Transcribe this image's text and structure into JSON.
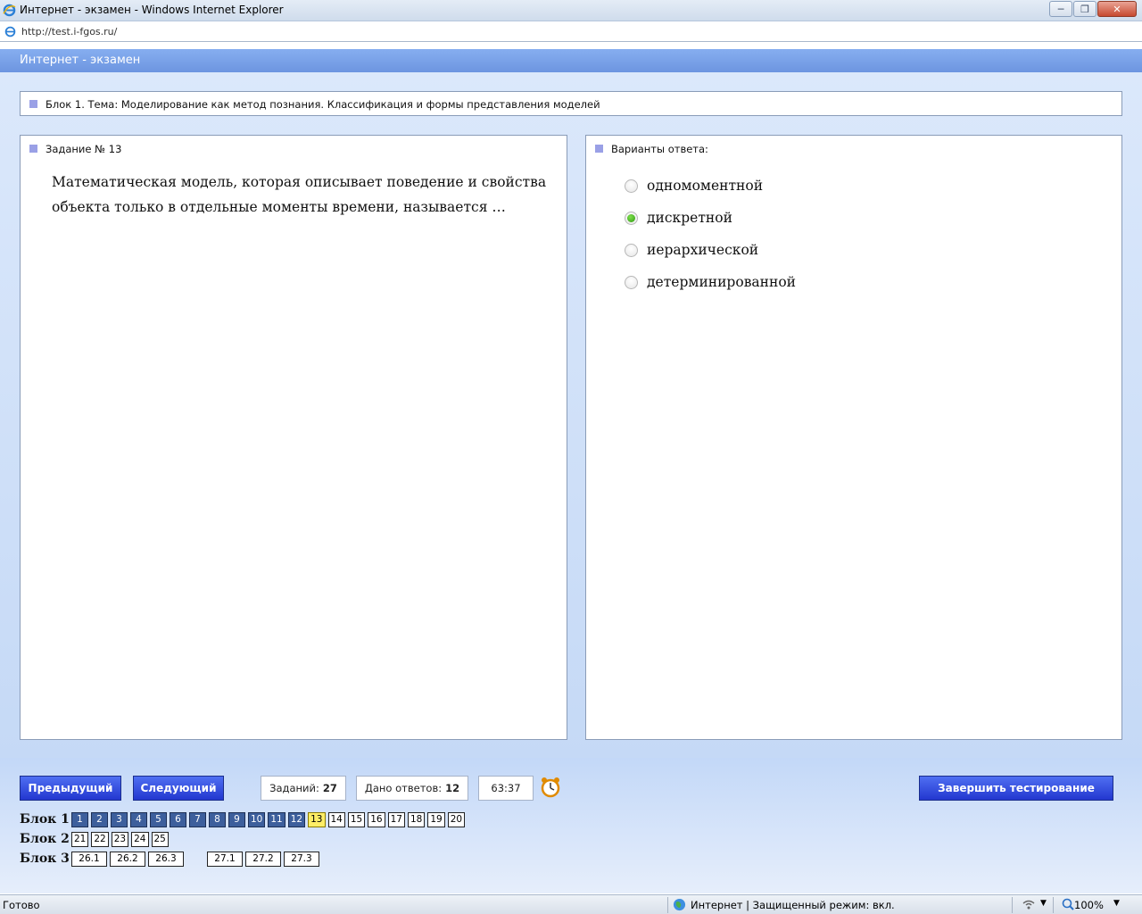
{
  "window": {
    "title": "Интернет - экзамен - Windows Internet Explorer"
  },
  "address": {
    "url": "http://test.i-fgos.ru/"
  },
  "page": {
    "header_title": "Интернет - экзамен",
    "block_title": "Блок 1. Тема: Моделирование как метод познания. Классификация и формы представления моделей"
  },
  "task": {
    "label": "Задание № 13",
    "question": "Математическая модель, которая описывает поведение и свойства объекта только в отдельные моменты времени, называется …"
  },
  "answers": {
    "label": "Варианты ответа:",
    "options": [
      {
        "text": "одномоментной",
        "selected": false
      },
      {
        "text": "дискретной",
        "selected": true
      },
      {
        "text": "иерархической",
        "selected": false
      },
      {
        "text": "детерминированной",
        "selected": false
      }
    ]
  },
  "controls": {
    "prev_label": "Предыдущий",
    "next_label": "Следующий",
    "tasks_label": "Заданий:",
    "tasks_count": "27",
    "answered_label": "Дано ответов:",
    "answered_count": "12",
    "timer": "63:37",
    "finish_label": "Завершить тестирование"
  },
  "navigator": {
    "blocks": [
      {
        "label": "Блок 1",
        "items": [
          "1",
          "2",
          "3",
          "4",
          "5",
          "6",
          "7",
          "8",
          "9",
          "10",
          "11",
          "12",
          "13",
          "14",
          "15",
          "16",
          "17",
          "18",
          "19",
          "20"
        ]
      },
      {
        "label": "Блок 2",
        "items": [
          "21",
          "22",
          "23",
          "24",
          "25"
        ]
      },
      {
        "label": "Блок 3",
        "items": [
          "26.1",
          "26.2",
          "26.3",
          "27.1",
          "27.2",
          "27.3"
        ]
      }
    ],
    "answered_items": [
      "1",
      "2",
      "3",
      "4",
      "5",
      "6",
      "7",
      "8",
      "9",
      "10",
      "11",
      "12"
    ],
    "current_item": "13"
  },
  "status": {
    "left": "Готово",
    "zone": "Интернет | Защищенный режим: вкл.",
    "zoom": "100%"
  },
  "colors": {
    "header_blue": "#7aa2ea",
    "button_blue": "#2f45dc",
    "answered_cell": "#3d5f9c",
    "current_cell": "#ffee66",
    "selected_radio": "#3aa61a"
  }
}
